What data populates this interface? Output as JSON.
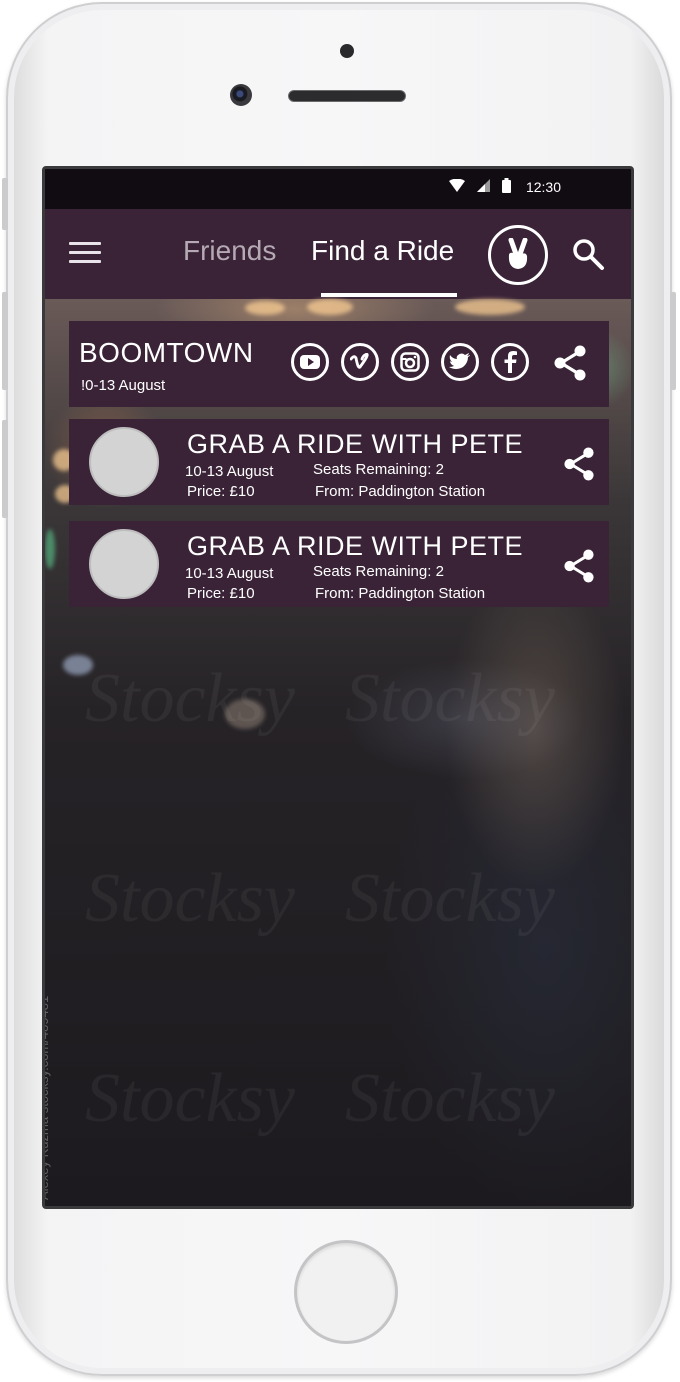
{
  "status_bar": {
    "time": "12:30",
    "icons": [
      "wifi-icon",
      "signal-icon",
      "battery-icon"
    ]
  },
  "app_bar": {
    "tabs": [
      {
        "label": "Friends",
        "active": false
      },
      {
        "label": "Find a Ride",
        "active": true
      }
    ],
    "icons": [
      "menu-icon",
      "peace-sign-icon",
      "search-icon"
    ]
  },
  "event": {
    "title": "BOOMTOWN",
    "date": "!0-13 August",
    "social_icons": [
      "youtube-icon",
      "vimeo-icon",
      "instagram-icon",
      "twitter-icon",
      "facebook-icon",
      "share-icon"
    ]
  },
  "rides": [
    {
      "title": "GRAB A RIDE WITH PETE",
      "date": "10-13 August",
      "price": "Price: £10",
      "seats": "Seats Remaining: 2",
      "from": "From: Paddington Station"
    },
    {
      "title": "GRAB A RIDE WITH PETE",
      "date": "10-13 August",
      "price": "Price: £10",
      "seats": "Seats Remaining: 2",
      "from": "From: Paddington Station"
    }
  ],
  "watermark": "Alexey Kuzma   stocksy.com/489481",
  "colors": {
    "accent": "#3a2337",
    "status_bar": "#110b12",
    "text": "#ffffff",
    "inactive_tab": "#b5a9b4"
  }
}
